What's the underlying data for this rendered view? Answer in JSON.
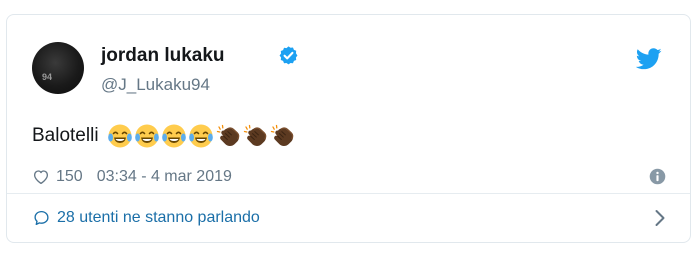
{
  "tweet": {
    "user": {
      "name": "jordan lukaku",
      "handle": "@J_Lukaku94",
      "verified": true,
      "avatar_jersey_number": "94"
    },
    "text": "Balotelli",
    "emojis": [
      "face-with-tears-of-joy",
      "face-with-tears-of-joy",
      "face-with-tears-of-joy",
      "face-with-tears-of-joy",
      "clapping-hands-dark-skin",
      "clapping-hands-dark-skin",
      "clapping-hands-dark-skin"
    ],
    "likes": "150",
    "timestamp": "03:34 - 4 mar 2019",
    "footer_text": "28 utenti ne stanno parlando"
  },
  "colors": {
    "twitter_blue": "#1da1f2",
    "link_blue": "#1b6fa8",
    "secondary_text": "#657786",
    "primary_text": "#14171a",
    "border": "#e1e8ed"
  },
  "icons": {
    "verified": "verified-badge-icon",
    "brand": "twitter-bird-icon",
    "like": "heart-icon",
    "info": "info-icon",
    "reply_count": "speech-bubble-icon",
    "expand": "chevron-right-icon"
  }
}
